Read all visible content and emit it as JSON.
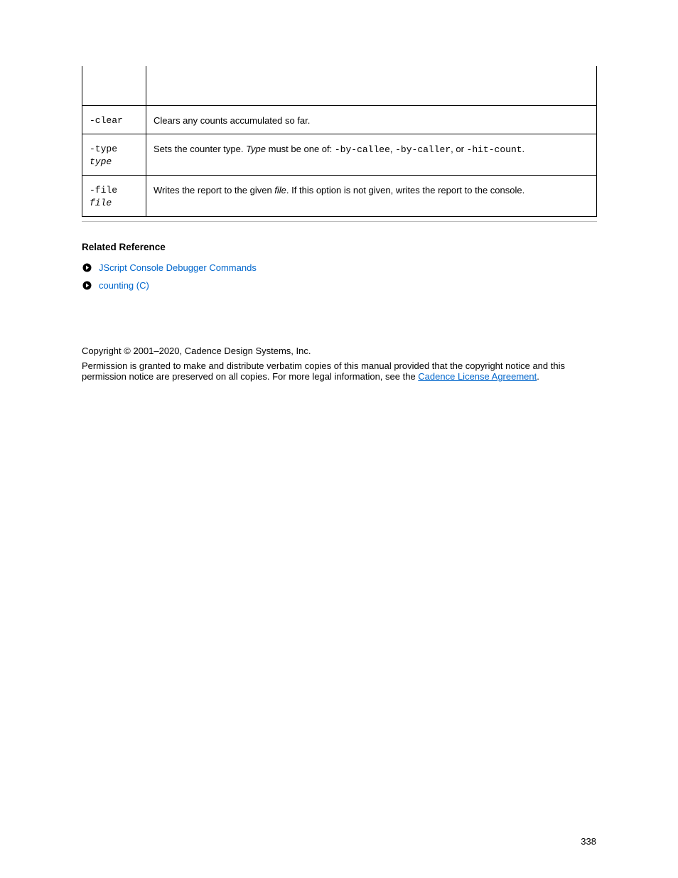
{
  "table": {
    "rows": [
      {
        "opt": "",
        "desc": ""
      },
      {
        "opt": "-clear",
        "desc": "Clears any counts accumulated so far."
      },
      {
        "opt": "-type type",
        "desc": "Sets the counter type. Type must be one of: -by-callee, -by-caller, or -hit-count."
      },
      {
        "opt": "-file file",
        "desc": "Writes the report to the given file. If this option is not given, writes the report to the console."
      }
    ]
  },
  "related": {
    "heading": "Related Reference",
    "items": [
      {
        "text": "JScript Console Debugger Commands"
      },
      {
        "text": "counting (C)"
      }
    ]
  },
  "footer": {
    "copyright": "Copyright © 2001–2020, Cadence Design Systems, Inc.",
    "permission_prefix": "Permission is granted to make and distribute verbatim copies of this manual provided that the copyright notice and this permission notice are preserved on all copies. For more legal information, see the ",
    "permission_link": "Cadence License Agreement",
    "permission_suffix": "."
  },
  "page_number": "338"
}
